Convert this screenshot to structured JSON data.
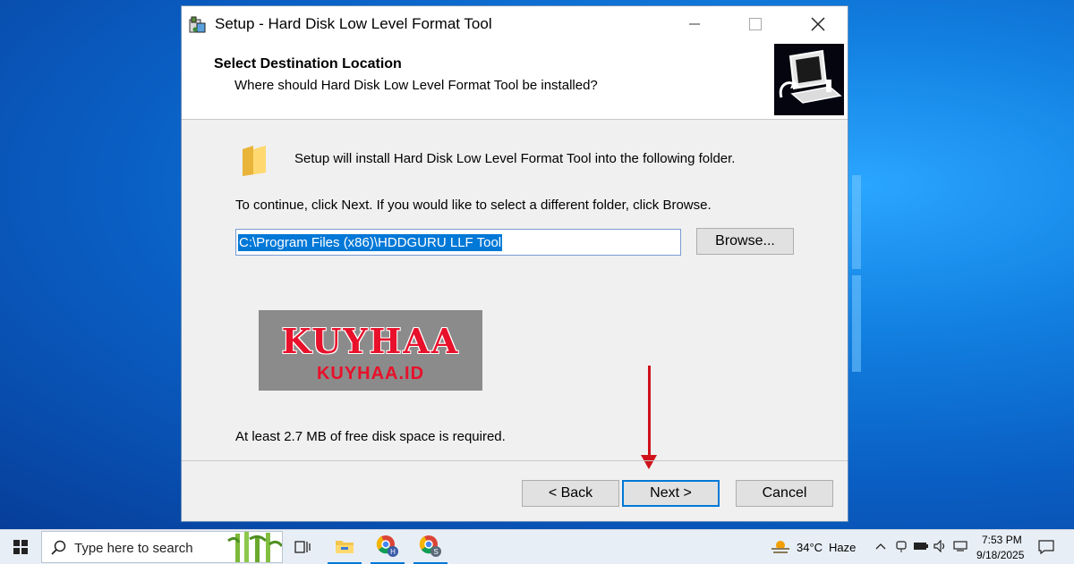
{
  "dialog": {
    "title": "Setup - Hard Disk Low Level Format Tool",
    "header_title": "Select Destination Location",
    "header_subtitle": "Where should Hard Disk Low Level Format Tool be installed?",
    "install_text": "Setup will install Hard Disk Low Level Format Tool into the following folder.",
    "continue_text": "To continue, click Next. If you would like to select a different folder, click Browse.",
    "path_value": "C:\\Program Files (x86)\\HDDGURU LLF Tool",
    "browse_label": "Browse...",
    "disk_space_text": "At least 2.7 MB of free disk space is required.",
    "back_label": "< Back",
    "next_label": "Next >",
    "cancel_label": "Cancel"
  },
  "watermark": {
    "big": "KUYHAA",
    "small": "KUYHAA.ID"
  },
  "taskbar": {
    "search_placeholder": "Type here to search",
    "weather_temp": "34°C",
    "weather_desc": "Haze",
    "time": "7:53 PM",
    "date": "9/18/2025"
  },
  "colors": {
    "accent": "#0078d7",
    "annotation_arrow": "#d0121b"
  }
}
